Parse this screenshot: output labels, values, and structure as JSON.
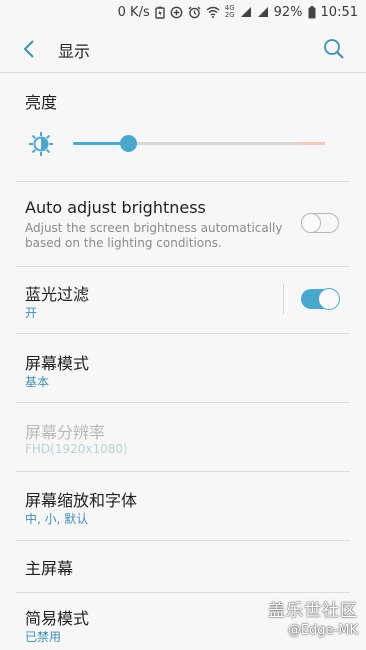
{
  "status_bar": {
    "net_speed": "0 K/s",
    "net_tag_top": "4G",
    "net_tag_bottom": "2G",
    "battery": "92%",
    "time": "10:51"
  },
  "app_bar": {
    "title": "显示"
  },
  "brightness": {
    "section_title": "亮度",
    "level": 0.22
  },
  "items": [
    {
      "title": "Auto adjust brightness",
      "desc": "Adjust the screen brightness automatically based on the lighting conditions.",
      "toggle": "off"
    },
    {
      "title": "蓝光过滤",
      "sub": "开",
      "toggle": "on"
    },
    {
      "title": "屏幕模式",
      "sub": "基本"
    },
    {
      "title": "屏幕分辨率",
      "sub": "FHD(1920x1080)",
      "disabled": true
    },
    {
      "title": "屏幕缩放和字体",
      "sub": "中, 小, 默认"
    },
    {
      "title": "主屏幕"
    },
    {
      "title": "简易模式",
      "sub": "已禁用"
    }
  ],
  "watermark": {
    "logo": "盖乐世社区",
    "user": "@Edge-MK"
  },
  "colors": {
    "accent": "#4aa8cf",
    "background": "#f7f7f7"
  }
}
